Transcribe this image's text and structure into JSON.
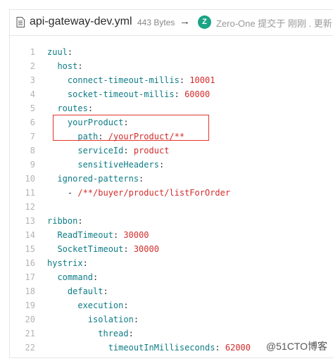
{
  "file": {
    "name": "api-gateway-dev.yml",
    "size": "443 Bytes",
    "arrow": "→",
    "avatar_letter": "Z",
    "commit_info": "Zero-One 提交于 刚刚 . 更新"
  },
  "code_lines": [
    {
      "n": "1",
      "indent": "",
      "key": "zuul",
      "sep": ":",
      "value": ""
    },
    {
      "n": "2",
      "indent": "  ",
      "key": "host",
      "sep": ":",
      "value": ""
    },
    {
      "n": "3",
      "indent": "    ",
      "key": "connect-timeout-millis",
      "sep": ": ",
      "value": "10001"
    },
    {
      "n": "4",
      "indent": "    ",
      "key": "socket-timeout-millis",
      "sep": ": ",
      "value": "60000"
    },
    {
      "n": "5",
      "indent": "  ",
      "key": "routes",
      "sep": ":",
      "value": ""
    },
    {
      "n": "6",
      "indent": "    ",
      "key": "yourProduct",
      "sep": ":",
      "value": ""
    },
    {
      "n": "7",
      "indent": "      ",
      "key": "path",
      "sep": ": ",
      "value": "/yourProduct/**"
    },
    {
      "n": "8",
      "indent": "      ",
      "key": "serviceId",
      "sep": ": ",
      "value": "product"
    },
    {
      "n": "9",
      "indent": "      ",
      "key": "sensitiveHeaders",
      "sep": ":",
      "value": ""
    },
    {
      "n": "10",
      "indent": "  ",
      "key": "ignored-patterns",
      "sep": ":",
      "value": ""
    },
    {
      "n": "11",
      "indent": "    ",
      "key": "- ",
      "sep": "",
      "value": "/**/buyer/product/listForOrder",
      "dash": true
    },
    {
      "n": "12",
      "indent": "",
      "key": "",
      "sep": "",
      "value": ""
    },
    {
      "n": "13",
      "indent": "",
      "key": "ribbon",
      "sep": ":",
      "value": ""
    },
    {
      "n": "14",
      "indent": "  ",
      "key": "ReadTimeout",
      "sep": ": ",
      "value": "30000"
    },
    {
      "n": "15",
      "indent": "  ",
      "key": "SocketTimeout",
      "sep": ": ",
      "value": "30000"
    },
    {
      "n": "16",
      "indent": "",
      "key": "hystrix",
      "sep": ":",
      "value": ""
    },
    {
      "n": "17",
      "indent": "  ",
      "key": "command",
      "sep": ":",
      "value": ""
    },
    {
      "n": "18",
      "indent": "    ",
      "key": "default",
      "sep": ":",
      "value": ""
    },
    {
      "n": "19",
      "indent": "      ",
      "key": "execution",
      "sep": ":",
      "value": ""
    },
    {
      "n": "20",
      "indent": "        ",
      "key": "isolation",
      "sep": ":",
      "value": ""
    },
    {
      "n": "21",
      "indent": "          ",
      "key": "thread",
      "sep": ":",
      "value": ""
    },
    {
      "n": "22",
      "indent": "            ",
      "key": "timeoutInMilliseconds",
      "sep": ": ",
      "value": "62000"
    }
  ],
  "watermark": "@51CTO博客",
  "colors": {
    "key": "#0e7c86",
    "value": "#d22b2b",
    "highlight_border": "#e0352b",
    "avatar": "#1aa385"
  }
}
